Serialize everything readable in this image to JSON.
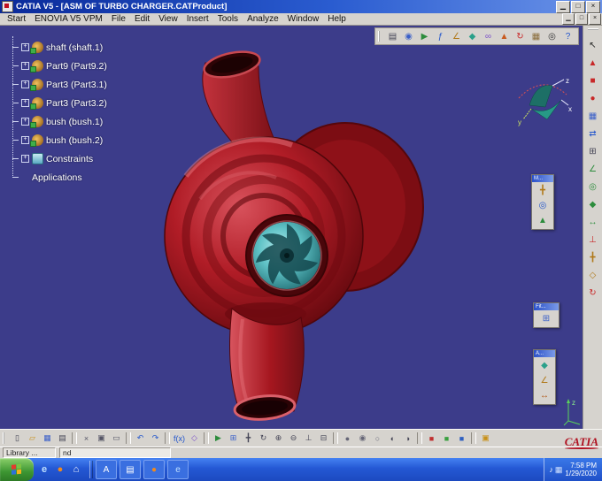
{
  "colors": {
    "titlebar_blue": "#0a2a9a",
    "toolbar_gray": "#d6d3ce",
    "viewport_bg": "#3c3c8a",
    "model_red": "#a5161f",
    "impeller_teal": "#6cc8cc",
    "taskbar_blue": "#2458d4",
    "start_green": "#3d9632",
    "brand_red": "#b01020"
  },
  "window": {
    "title": "CATIA V5 - [ASM OF TURBO CHARGER.CATProduct]",
    "controls": [
      {
        "name": "minimize-button",
        "glyph": "▁"
      },
      {
        "name": "maximize-button",
        "glyph": "□"
      },
      {
        "name": "close-button",
        "glyph": "×"
      }
    ],
    "mdi_controls": [
      {
        "name": "mdi-minimize-button",
        "glyph": "▁"
      },
      {
        "name": "mdi-restore-button",
        "glyph": "□"
      },
      {
        "name": "mdi-close-button",
        "glyph": "×"
      }
    ]
  },
  "menu": {
    "items": [
      {
        "label": "Start"
      },
      {
        "label": "ENOVIA V5 VPM"
      },
      {
        "label": "File"
      },
      {
        "label": "Edit"
      },
      {
        "label": "View"
      },
      {
        "label": "Insert"
      },
      {
        "label": "Tools"
      },
      {
        "label": "Analyze"
      },
      {
        "label": "Window"
      },
      {
        "label": "Help"
      }
    ]
  },
  "top_toolbar": {
    "icons": [
      {
        "name": "print-icon",
        "glyph": "▤",
        "color": "#445"
      },
      {
        "name": "camera-icon",
        "glyph": "◉",
        "color": "#3a5fc8"
      },
      {
        "name": "fly-mode-icon",
        "glyph": "▶",
        "color": "#2c8c3c"
      },
      {
        "name": "knowledge-formula-icon",
        "glyph": "ƒ",
        "color": "#2255cc"
      },
      {
        "name": "measure-icon",
        "glyph": "∠",
        "color": "#b07818"
      },
      {
        "name": "apply-material-icon",
        "glyph": "◆",
        "color": "#2aa08a"
      },
      {
        "name": "link-manager-icon",
        "glyph": "∞",
        "color": "#7a4fc8"
      },
      {
        "name": "publish-icon",
        "glyph": "▲",
        "color": "#c85a1e"
      },
      {
        "name": "update-icon",
        "glyph": "↻",
        "color": "#c82828"
      },
      {
        "name": "catalog-icon",
        "glyph": "▦",
        "color": "#8a6d3b"
      },
      {
        "name": "search-icon",
        "glyph": "◎",
        "color": "#333"
      },
      {
        "name": "help-icon",
        "glyph": "?",
        "color": "#2255cc"
      }
    ]
  },
  "tree": {
    "items": [
      {
        "label": "shaft (shaft.1)",
        "icon": "part",
        "exp": "true"
      },
      {
        "label": "Part9 (Part9.2)",
        "icon": "part",
        "exp": "true"
      },
      {
        "label": "Part3 (Part3.1)",
        "icon": "part",
        "exp": "true"
      },
      {
        "label": "Part3 (Part3.2)",
        "icon": "part",
        "exp": "true"
      },
      {
        "label": "bush (bush.1)",
        "icon": "part",
        "exp": "true"
      },
      {
        "label": "bush (bush.2)",
        "icon": "part",
        "exp": "true"
      },
      {
        "label": "Constraints",
        "icon": "constraints",
        "exp": "true"
      },
      {
        "label": "Applications",
        "icon": "none",
        "exp": "false"
      }
    ]
  },
  "viewport": {
    "compass": {
      "x_label": "x",
      "y_label": "y",
      "z_label": "z"
    },
    "axis_indicator": {
      "label": "z"
    },
    "floating_panels": [
      {
        "title": "M...",
        "icons": [
          {
            "name": "manipulate-icon",
            "glyph": "╋",
            "color": "#b07818"
          },
          {
            "name": "snap-icon",
            "glyph": "◎",
            "color": "#2255cc"
          },
          {
            "name": "smart-move-icon",
            "glyph": "▲",
            "color": "#2c8c3c"
          }
        ]
      },
      {
        "title": "Fit...",
        "icons": [
          {
            "name": "fit-all-in-icon",
            "glyph": "⊞",
            "color": "#3a5fc8"
          }
        ]
      },
      {
        "title": "A...",
        "icons": [
          {
            "name": "apply-material-icon",
            "glyph": "◆",
            "color": "#2aa08a"
          },
          {
            "name": "measure-between-icon",
            "glyph": "∠",
            "color": "#b07818"
          },
          {
            "name": "measure-item-icon",
            "glyph": "↔",
            "color": "#b05818"
          }
        ]
      }
    ]
  },
  "right_toolbar": {
    "icons": [
      {
        "name": "select-arrow-icon",
        "glyph": "↖",
        "color": "#222"
      },
      {
        "name": "new-product-icon",
        "glyph": "▲",
        "color": "#c82828"
      },
      {
        "name": "new-component-icon",
        "glyph": "■",
        "color": "#c82828"
      },
      {
        "name": "new-part-icon",
        "glyph": "●",
        "color": "#c82828"
      },
      {
        "name": "existing-component-icon",
        "glyph": "▦",
        "color": "#3a5fc8"
      },
      {
        "name": "replace-component-icon",
        "glyph": "⇄",
        "color": "#2255cc"
      },
      {
        "name": "graph-tree-reordering-icon",
        "glyph": "⊞",
        "color": "#445"
      },
      {
        "name": "constraint-angle-icon",
        "glyph": "∠",
        "color": "#2c8c3c"
      },
      {
        "name": "coincidence-constraint-icon",
        "glyph": "◎",
        "color": "#2c8c3c"
      },
      {
        "name": "contact-constraint-icon",
        "glyph": "◆",
        "color": "#2c8c3c"
      },
      {
        "name": "offset-constraint-icon",
        "glyph": "↔",
        "color": "#2c8c3c"
      },
      {
        "name": "fix-component-icon",
        "glyph": "⊥",
        "color": "#c82828"
      },
      {
        "name": "manipulation-icon",
        "glyph": "╋",
        "color": "#b07818"
      },
      {
        "name": "explode-icon",
        "glyph": "◇",
        "color": "#b07818"
      },
      {
        "name": "update-all-icon",
        "glyph": "↻",
        "color": "#c82828"
      }
    ]
  },
  "bottom_toolbar": {
    "icons": [
      {
        "name": "new-document-icon",
        "glyph": "▯",
        "color": "#445",
        "kind": "icon"
      },
      {
        "name": "open-icon",
        "glyph": "▱",
        "color": "#c89018",
        "kind": "icon"
      },
      {
        "name": "save-icon",
        "glyph": "▦",
        "color": "#3a5fc8",
        "kind": "icon"
      },
      {
        "name": "print-icon",
        "glyph": "▤",
        "color": "#445",
        "kind": "icon"
      },
      {
        "name": "separator",
        "glyph": "",
        "kind": "sep",
        "inter": "false"
      },
      {
        "name": "cut-icon",
        "glyph": "×",
        "color": "#556",
        "kind": "icon"
      },
      {
        "name": "copy-icon",
        "glyph": "▣",
        "color": "#556",
        "kind": "icon"
      },
      {
        "name": "paste-icon",
        "glyph": "▭",
        "color": "#556",
        "kind": "icon"
      },
      {
        "name": "separator",
        "glyph": "",
        "kind": "sep",
        "inter": "false"
      },
      {
        "name": "undo-icon",
        "glyph": "↶",
        "color": "#2255cc",
        "kind": "icon"
      },
      {
        "name": "redo-icon",
        "glyph": "↷",
        "color": "#2255cc",
        "kind": "icon"
      },
      {
        "name": "separator",
        "glyph": "",
        "kind": "sep",
        "inter": "false"
      },
      {
        "name": "formula-icon",
        "glyph": "f(x)",
        "color": "#2255cc",
        "kind": "icon"
      },
      {
        "name": "macro-icon",
        "glyph": "◇",
        "color": "#7a4fc8",
        "kind": "icon"
      },
      {
        "name": "separator",
        "glyph": "",
        "kind": "sep",
        "inter": "false"
      },
      {
        "name": "fly-mode-icon",
        "glyph": "▶",
        "color": "#2c8c3c",
        "kind": "icon"
      },
      {
        "name": "fit-all-in-icon",
        "glyph": "⊞",
        "color": "#3a5fc8",
        "kind": "icon"
      },
      {
        "name": "pan-icon",
        "glyph": "╋",
        "color": "#445",
        "kind": "icon"
      },
      {
        "name": "rotate-icon",
        "glyph": "↻",
        "color": "#445",
        "kind": "icon"
      },
      {
        "name": "zoom-in-icon",
        "glyph": "⊕",
        "color": "#445",
        "kind": "icon"
      },
      {
        "name": "zoom-out-icon",
        "glyph": "⊖",
        "color": "#445",
        "kind": "icon"
      },
      {
        "name": "normal-view-icon",
        "glyph": "⊥",
        "color": "#445",
        "kind": "icon"
      },
      {
        "name": "multi-view-icon",
        "glyph": "⊟",
        "color": "#445",
        "kind": "icon"
      },
      {
        "name": "separator",
        "glyph": "",
        "kind": "sep",
        "inter": "false"
      },
      {
        "name": "shaded-view-icon",
        "glyph": "●",
        "color": "#667",
        "kind": "icon"
      },
      {
        "name": "shaded-edges-view-icon",
        "glyph": "◉",
        "color": "#667",
        "kind": "icon"
      },
      {
        "name": "wireframe-view-icon",
        "glyph": "○",
        "color": "#667",
        "kind": "icon"
      },
      {
        "name": "hide-show-icon",
        "glyph": "◐",
        "color": "#445",
        "kind": "icon"
      },
      {
        "name": "swap-visible-space-icon",
        "glyph": "◑",
        "color": "#445",
        "kind": "icon"
      },
      {
        "name": "separator",
        "glyph": "",
        "kind": "sep",
        "inter": "false"
      },
      {
        "name": "red-properties-icon",
        "glyph": "■",
        "color": "#c03030",
        "kind": "icon"
      },
      {
        "name": "green-properties-icon",
        "glyph": "■",
        "color": "#3aa040",
        "kind": "icon"
      },
      {
        "name": "blue-properties-icon",
        "glyph": "■",
        "color": "#3060c0",
        "kind": "icon"
      },
      {
        "name": "separator",
        "glyph": "",
        "kind": "sep",
        "inter": "false"
      },
      {
        "name": "catalog-browser-icon",
        "glyph": "▣",
        "color": "#c89018",
        "kind": "icon"
      }
    ]
  },
  "statusbar": {
    "library_label": "Library ...",
    "command_value": "nd",
    "brand": "CATIA"
  },
  "taskbar": {
    "quick_launch": [
      {
        "name": "internet-explorer-icon",
        "glyph": "e",
        "color": "#bfe0ff"
      },
      {
        "name": "firefox-icon",
        "glyph": "●",
        "color": "#f08a1e"
      },
      {
        "name": "show-desktop-icon",
        "glyph": "⌂",
        "color": "#ffffff"
      }
    ],
    "buttons": [
      {
        "name": "app-a-taskbar-icon",
        "glyph": "A",
        "color": "#ffffff"
      },
      {
        "name": "notepad-taskbar-icon",
        "glyph": "▤",
        "color": "#ffffff"
      },
      {
        "name": "firefox-taskbar-icon",
        "glyph": "●",
        "color": "#f08a1e"
      },
      {
        "name": "internet-explorer-taskbar-icon",
        "glyph": "e",
        "color": "#bfe0ff"
      }
    ],
    "tray": {
      "icons": [
        {
          "name": "volume-icon",
          "glyph": "♪",
          "color": "#ffffff"
        },
        {
          "name": "network-icon",
          "glyph": "▦",
          "color": "#cfe0ff"
        }
      ],
      "time": "7:58 PM",
      "date": "1/29/2020"
    }
  }
}
